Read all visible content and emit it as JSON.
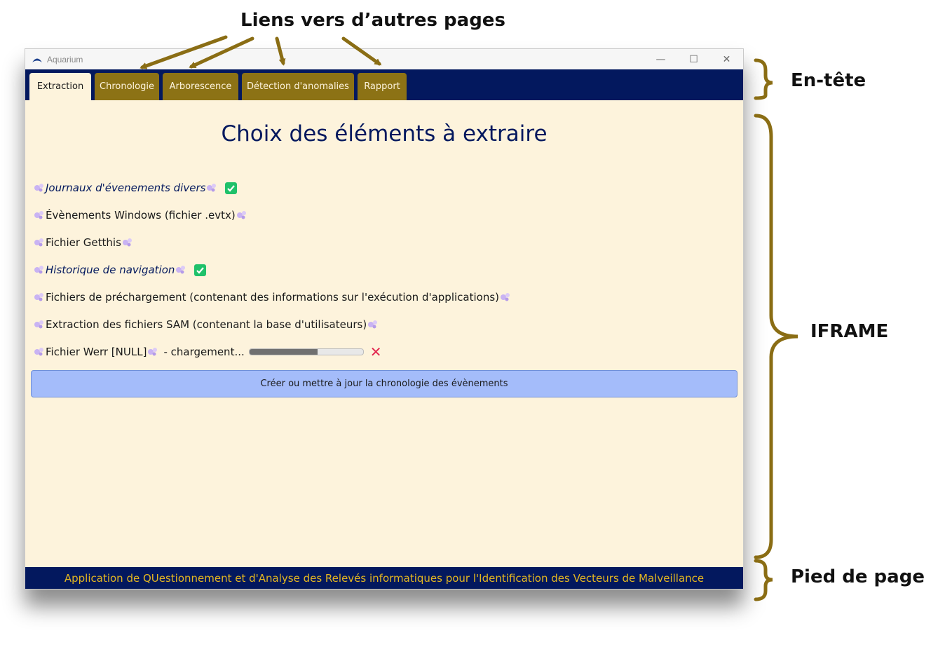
{
  "annotations": {
    "links": "Liens vers d’autres pages",
    "header": "En-tête",
    "iframe": "IFRAME",
    "footer": "Pied de page"
  },
  "window": {
    "title": "Aquarium",
    "minimize_glyph": "—",
    "maximize_glyph": "☐",
    "close_glyph": "✕"
  },
  "tabs": [
    {
      "label": "Extraction",
      "active": true
    },
    {
      "label": "Chronologie",
      "active": false
    },
    {
      "label": "Arborescence",
      "active": false
    },
    {
      "label": "Détection d'anomalies",
      "active": false
    },
    {
      "label": "Rapport",
      "active": false
    }
  ],
  "main": {
    "title": "Choix des éléments à extraire",
    "items": [
      {
        "label": "Journaux d'évenements divers",
        "italic": true,
        "status": "checked"
      },
      {
        "label": "Évènements Windows (fichier .evtx)",
        "italic": false,
        "status": ""
      },
      {
        "label": "Fichier Getthis",
        "italic": false,
        "status": ""
      },
      {
        "label": "Historique de navigation",
        "italic": true,
        "status": "checked"
      },
      {
        "label": "Fichiers de préchargement (contenant des informations sur l'exécution d'applications)",
        "italic": false,
        "status": ""
      },
      {
        "label": "Extraction des fichiers SAM (contenant la base d'utilisateurs)",
        "italic": false,
        "status": ""
      },
      {
        "label": "Fichier Werr [NULL]",
        "italic": false,
        "status": "loading",
        "loading_text": "- chargement...",
        "progress": 0.6,
        "cancel_glyph": "✕"
      }
    ],
    "action_button": "Créer ou mettre à jour la chronologie des évènements"
  },
  "footer": {
    "text": "Application de QUestionnement et d'Analyse des Relevés informatiques pour l'Identification des Vecteurs de Malveillance"
  },
  "colors": {
    "navy": "#03185e",
    "gold": "#8c7215",
    "cream": "#fdf3dc",
    "button_blue": "#a4bcfa",
    "check_green": "#1fc16a",
    "cancel_red": "#e22850",
    "annotation_arrow": "#8a6d14"
  },
  "icons": {
    "sparkle": "sparkle-icon",
    "check": "checkmark-icon",
    "cancel": "close-icon",
    "app": "aquarium-logo-icon"
  }
}
